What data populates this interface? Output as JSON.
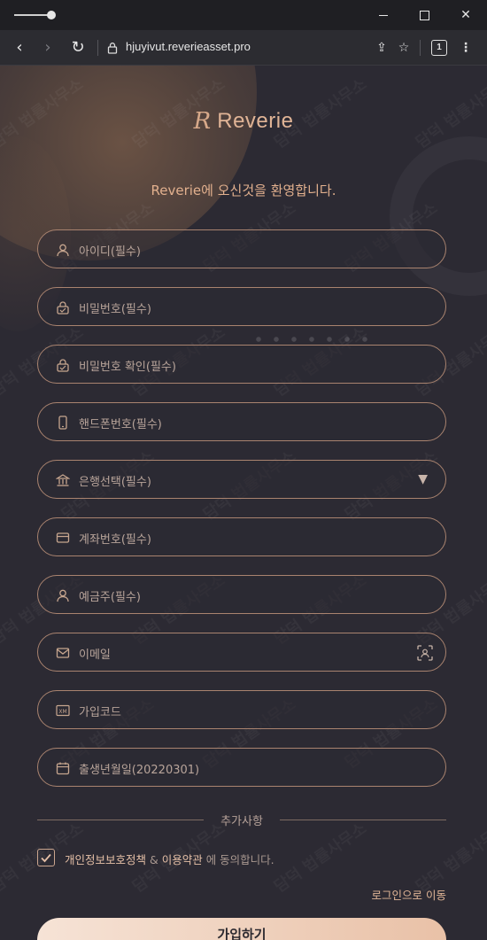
{
  "browser": {
    "url": "hjuyivut.reverieasset.pro",
    "tab_count": "1",
    "icons": {
      "back": "back-arrow-icon",
      "forward": "forward-arrow-icon",
      "reload": "reload-icon",
      "lock": "lock-icon",
      "share": "share-icon",
      "favorite": "favorite-icon",
      "more": "more-vertical-icon"
    }
  },
  "brand": {
    "mark": "R",
    "name": "Reverie"
  },
  "welcome": "Reverie에 오신것을 환영합니다.",
  "form": {
    "fields": [
      {
        "placeholder": "아이디(필수)",
        "icon": "user-icon"
      },
      {
        "placeholder": "비밀번호(필수)",
        "icon": "lock-icon"
      },
      {
        "placeholder": "비밀번호 확인(필수)",
        "icon": "lock-icon"
      },
      {
        "placeholder": "핸드폰번호(필수)",
        "icon": "phone-icon"
      },
      {
        "placeholder": "은행선택(필수)",
        "icon": "bank-icon",
        "dropdown_arrow": "▼"
      },
      {
        "placeholder": "계좌번호(필수)",
        "icon": "card-icon"
      },
      {
        "placeholder": "예금주(필수)",
        "icon": "user-icon"
      },
      {
        "placeholder": "이메일",
        "icon": "mail-icon",
        "trailing_icon": "scan-icon"
      },
      {
        "placeholder": "가입코드",
        "icon": "code-icon"
      },
      {
        "placeholder": "출생년월일(20220301)",
        "icon": "calendar-icon"
      }
    ],
    "divider_label": "추가사항",
    "agreement": {
      "checked": true,
      "privacy": "개인정보보호정책",
      "amp": " & ",
      "terms": "이용약관",
      "suffix": " 에 동의합니다."
    },
    "login_link": "로그인으로 이동",
    "submit_label": "가입하기"
  },
  "watermark": "담덕 법률사무소",
  "colors": {
    "accent": "#e0b496",
    "background": "#2c2a33",
    "field_border": "#a9836f"
  }
}
